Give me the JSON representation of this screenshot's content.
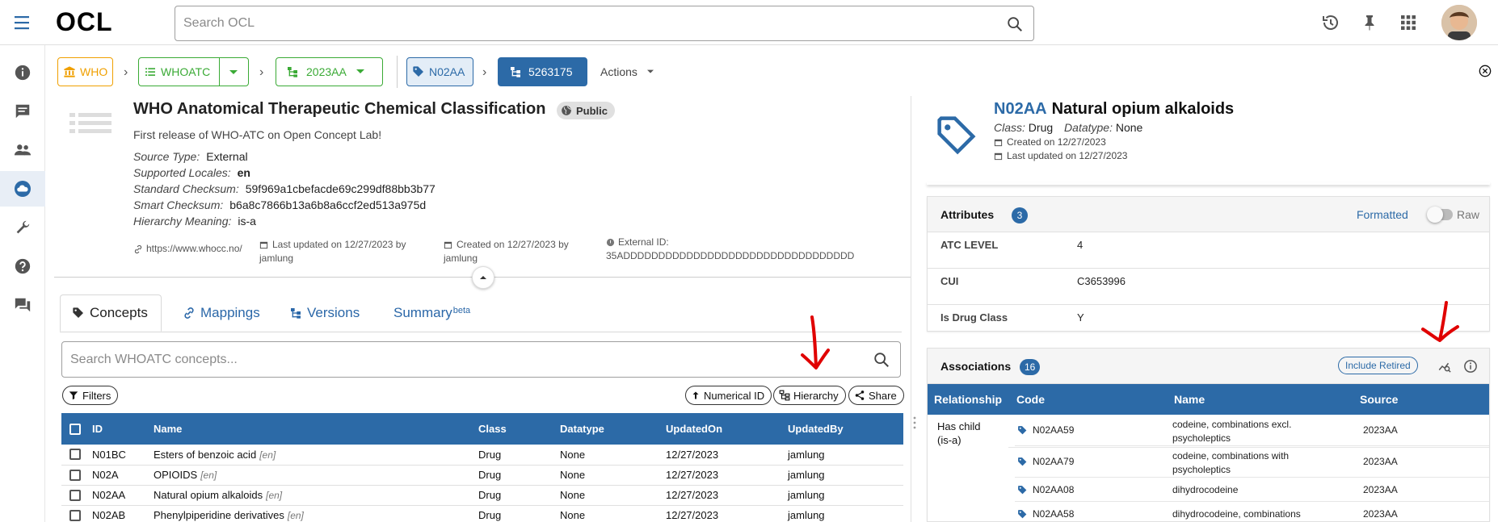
{
  "app": {
    "logo": "OCL"
  },
  "search": {
    "placeholder": "Search OCL"
  },
  "breadcrumb": {
    "org": "WHO",
    "source": "WHOATC",
    "version": "2023AA",
    "concept": "N02AA",
    "concept_version": "5263175",
    "actions": "Actions"
  },
  "source": {
    "title": "WHO Anatomical Therapeutic Chemical Classification",
    "visibility": "Public",
    "description": "First release of WHO-ATC on Open Concept Lab!",
    "meta": [
      {
        "key": "Source Type:",
        "value": "External"
      },
      {
        "key": "Supported Locales:",
        "value": "en"
      },
      {
        "key": "Standard Checksum:",
        "value": "59f969a1cbefacde69c299df88bb3b77"
      },
      {
        "key": "Smart Checksum:",
        "value": "b6a8c7866b13a6b8a6ccf2ed513a975d"
      },
      {
        "key": "Hierarchy Meaning:",
        "value": "is-a"
      }
    ],
    "website": "https://www.whocc.no/",
    "last_updated": "Last updated on 12/27/2023 by",
    "last_updated_by": "jamlung",
    "created": "Created on 12/27/2023 by",
    "created_by": "jamlung",
    "external_id_label": "External ID:",
    "external_id": "35ADDDDDDDDDDDDDDDDDDDDDDDDDDDDDDDDD"
  },
  "tabs": {
    "concepts": "Concepts",
    "mappings": "Mappings",
    "versions": "Versions",
    "summary": "Summary",
    "summary_sup": "beta"
  },
  "concept_search": {
    "placeholder": "Search WHOATC concepts..."
  },
  "toolbar": {
    "filters": "Filters",
    "numerical_id": "Numerical ID",
    "hierarchy": "Hierarchy",
    "share": "Share"
  },
  "concepts_table": {
    "headers": [
      "ID",
      "Name",
      "Class",
      "Datatype",
      "UpdatedOn",
      "UpdatedBy"
    ],
    "rows": [
      {
        "id": "N01BC",
        "name": "Esters of benzoic acid",
        "locale": "[en]",
        "class": "Drug",
        "datatype": "None",
        "updated_on": "12/27/2023",
        "updated_by": "jamlung"
      },
      {
        "id": "N02A",
        "name": "OPIOIDS",
        "locale": "[en]",
        "class": "Drug",
        "datatype": "None",
        "updated_on": "12/27/2023",
        "updated_by": "jamlung"
      },
      {
        "id": "N02AA",
        "name": "Natural opium alkaloids",
        "locale": "[en]",
        "class": "Drug",
        "datatype": "None",
        "updated_on": "12/27/2023",
        "updated_by": "jamlung"
      },
      {
        "id": "N02AB",
        "name": "Phenylpiperidine derivatives",
        "locale": "[en]",
        "class": "Drug",
        "datatype": "None",
        "updated_on": "12/27/2023",
        "updated_by": "jamlung"
      }
    ]
  },
  "concept_detail": {
    "code": "N02AA",
    "name": "Natural opium alkaloids",
    "class_label": "Class:",
    "class_value": "Drug",
    "datatype_label": "Datatype:",
    "datatype_value": "None",
    "created": "Created on 12/27/2023",
    "updated": "Last updated on 12/27/2023"
  },
  "attributes": {
    "title": "Attributes",
    "count": "3",
    "formatted": "Formatted",
    "raw": "Raw",
    "rows": [
      {
        "key": "ATC LEVEL",
        "value": "4"
      },
      {
        "key": "CUI",
        "value": "C3653996"
      },
      {
        "key": "Is Drug Class",
        "value": "Y"
      }
    ]
  },
  "associations": {
    "title": "Associations",
    "count": "16",
    "include_retired": "Include Retired",
    "headers": [
      "Relationship",
      "Code",
      "Name",
      "Source"
    ],
    "relationship": "Has child",
    "relationship_type": "(is-a)",
    "rows": [
      {
        "code": "N02AA59",
        "name": "codeine, combinations excl. psycholeptics",
        "source": "2023AA"
      },
      {
        "code": "N02AA79",
        "name": "codeine, combinations with psycholeptics",
        "source": "2023AA"
      },
      {
        "code": "N02AA08",
        "name": "dihydrocodeine",
        "source": "2023AA"
      },
      {
        "code": "N02AA58",
        "name": "dihydrocodeine, combinations",
        "source": "2023AA"
      }
    ]
  },
  "colors": {
    "primary": "#2c6aa7",
    "org_orange": "#f0a000",
    "source_green": "#3aaa35",
    "annotation_red": "#e00000"
  }
}
